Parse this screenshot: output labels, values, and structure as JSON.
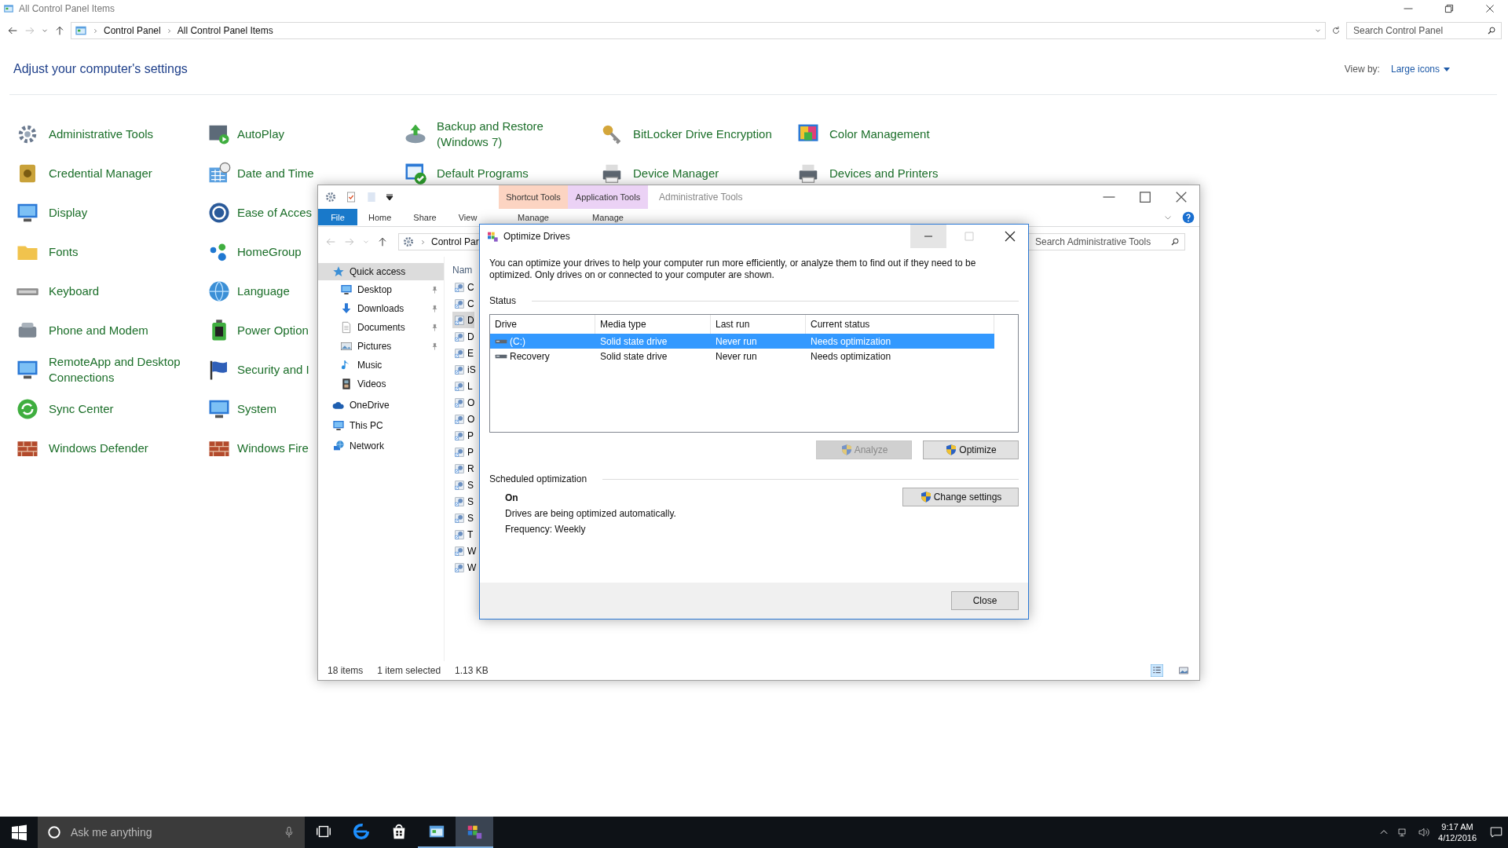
{
  "control_panel": {
    "title": "All Control Panel Items",
    "breadcrumb": [
      "Control Panel",
      "All Control Panel Items"
    ],
    "search": {
      "placeholder": "Search Control Panel"
    },
    "heading": "Adjust your computer's settings",
    "view_by": {
      "label": "View by:",
      "value": "Large icons"
    },
    "columns": [
      [
        "Administrative Tools",
        "Credential Manager",
        "Display",
        "Fonts",
        "Keyboard",
        "Phone and Modem",
        "RemoteApp and Desktop Connections",
        "Sync Center",
        "Windows Defender"
      ],
      [
        "AutoPlay",
        "Date and Time",
        "Ease of Acces",
        "HomeGroup",
        "Language",
        "Power Option",
        "Security and I",
        "System",
        "Windows Fire"
      ],
      [
        "Backup and Restore (Windows 7)",
        "Default Programs"
      ],
      [
        "BitLocker Drive Encryption",
        "Device Manager"
      ],
      [
        "Color Management",
        "Devices and Printers"
      ]
    ]
  },
  "explorer": {
    "title": "Administrative Tools",
    "context_tabs": [
      {
        "label": "Shortcut Tools",
        "tab": "Manage",
        "color": "#fcd4c2"
      },
      {
        "label": "Application Tools",
        "tab": "Manage",
        "color": "#ebd2f5"
      }
    ],
    "ribbon_tabs": [
      {
        "label": "File",
        "kind": "file"
      },
      {
        "label": "Home",
        "kind": "tab"
      },
      {
        "label": "Share",
        "kind": "tab"
      },
      {
        "label": "View",
        "kind": "tab"
      }
    ],
    "address": "Control Par",
    "search": {
      "placeholder": "Search Administrative Tools"
    },
    "nav": [
      {
        "label": "Quick access",
        "selected": true,
        "children": [
          {
            "label": "Desktop",
            "pinned": true,
            "selected": false
          },
          {
            "label": "Downloads",
            "pinned": true,
            "selected": false
          },
          {
            "label": "Documents",
            "pinned": true,
            "selected": false
          },
          {
            "label": "Pictures",
            "pinned": true,
            "selected": false
          },
          {
            "label": "Music",
            "pinned": false,
            "selected": false
          },
          {
            "label": "Videos",
            "pinned": false,
            "selected": false
          }
        ]
      },
      {
        "label": "OneDrive",
        "selected": false
      },
      {
        "label": "This PC",
        "selected": false
      },
      {
        "label": "Network",
        "selected": false
      }
    ],
    "column_header": "Nam",
    "files": [
      {
        "label": "C",
        "selected": false
      },
      {
        "label": "C",
        "selected": false
      },
      {
        "label": "D",
        "selected": true
      },
      {
        "label": "D",
        "selected": false
      },
      {
        "label": "E",
        "selected": false
      },
      {
        "label": "iS",
        "selected": false
      },
      {
        "label": "L",
        "selected": false
      },
      {
        "label": "O",
        "selected": false
      },
      {
        "label": "O",
        "selected": false
      },
      {
        "label": "P",
        "selected": false
      },
      {
        "label": "P",
        "selected": false
      },
      {
        "label": "R",
        "selected": false
      },
      {
        "label": "S",
        "selected": false
      },
      {
        "label": "S",
        "selected": false
      },
      {
        "label": "S",
        "selected": false
      },
      {
        "label": "T",
        "selected": false
      },
      {
        "label": "W",
        "selected": false
      },
      {
        "label": "W",
        "selected": false
      }
    ],
    "status": [
      "18 items",
      "1 item selected",
      "1.13 KB"
    ],
    "views": [
      {
        "selected": true
      },
      {
        "selected": false
      }
    ]
  },
  "dialog": {
    "title": "Optimize Drives",
    "description": "You can optimize your drives to help your computer run more efficiently, or analyze them to find out if they need to be optimized. Only drives on or connected to your computer are shown.",
    "status_label": "Status",
    "columns": [
      "Drive",
      "Media type",
      "Last run",
      "Current status"
    ],
    "drives": [
      {
        "cells": [
          "(C:)",
          "Solid state drive",
          "Never run",
          "Needs optimization"
        ],
        "selected": true
      },
      {
        "cells": [
          "Recovery",
          "Solid state drive",
          "Never run",
          "Needs optimization"
        ],
        "selected": false
      }
    ],
    "actions": [
      {
        "label": "Analyze",
        "disabled": true
      },
      {
        "label": "Optimize",
        "disabled": false
      }
    ],
    "schedule": {
      "label": "Scheduled optimization",
      "state": "On",
      "note": "Drives are being optimized automatically.",
      "frequency": "Frequency: Weekly",
      "button": "Change settings"
    },
    "close": "Close"
  },
  "taskbar": {
    "search": {
      "placeholder": "Ask me anything"
    },
    "apps": [
      {
        "open": false,
        "selected": false
      },
      {
        "open": false,
        "selected": false
      },
      {
        "open": false,
        "selected": false
      },
      {
        "open": true,
        "selected": false
      },
      {
        "open": true,
        "selected": true
      }
    ],
    "time": "9:17 AM",
    "date": "4/12/2016"
  }
}
